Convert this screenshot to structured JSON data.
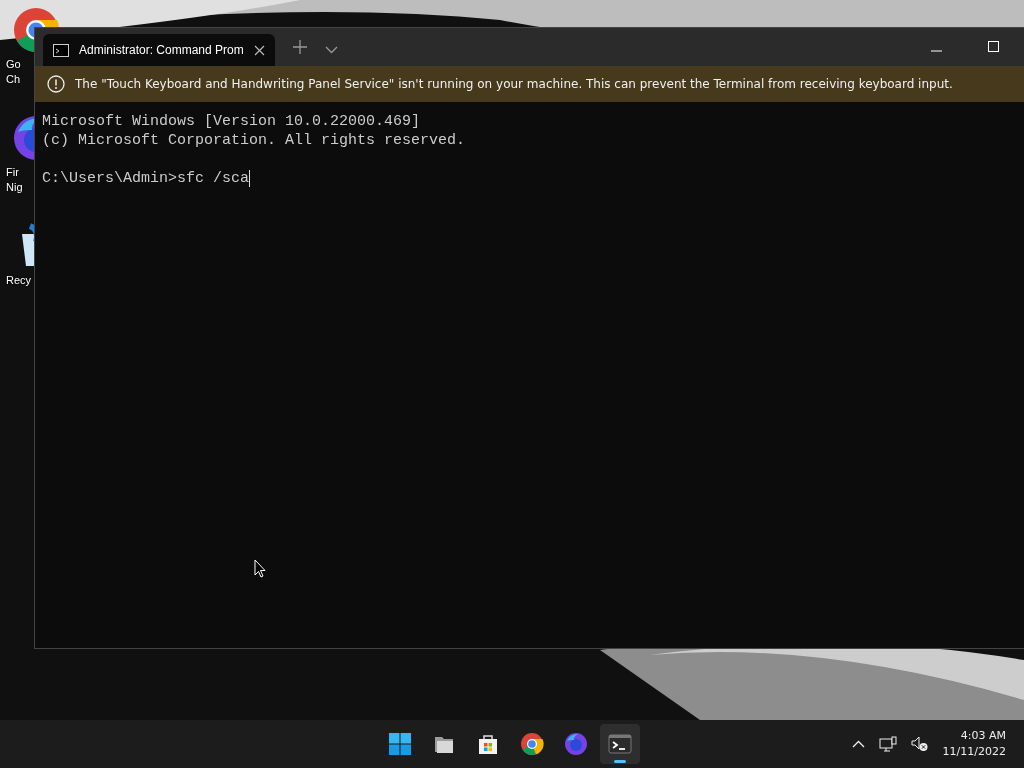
{
  "desktop_icons": [
    {
      "kind": "chrome",
      "lines": [
        "Go",
        "Ch"
      ]
    },
    {
      "kind": "firefox",
      "lines": [
        "Fir",
        "Nig"
      ]
    },
    {
      "kind": "recycle",
      "lines": [
        "Recy"
      ]
    }
  ],
  "window": {
    "tab": {
      "title": "Administrator: Command Prom",
      "selected": true
    },
    "warning": "The \"Touch Keyboard and Handwriting Panel Service\" isn't running on your machine. This can prevent the Terminal from receiving keyboard input.",
    "output": [
      [
        "Microsoft Windows [Version 10.0.22000.469]",
        "(c) Microsoft Corporation. All rights reserved."
      ]
    ],
    "prompt": "C:\\Users\\Admin>",
    "command": "sfc /sca"
  },
  "taskbar": {
    "apps": [
      {
        "kind": "start",
        "selected": false
      },
      {
        "kind": "files",
        "selected": false
      },
      {
        "kind": "store",
        "selected": false
      },
      {
        "kind": "chrome",
        "selected": false
      },
      {
        "kind": "firefox",
        "selected": false
      },
      {
        "kind": "terminal",
        "selected": true
      }
    ],
    "time": "4:03 AM",
    "date": "11/11/2022"
  }
}
